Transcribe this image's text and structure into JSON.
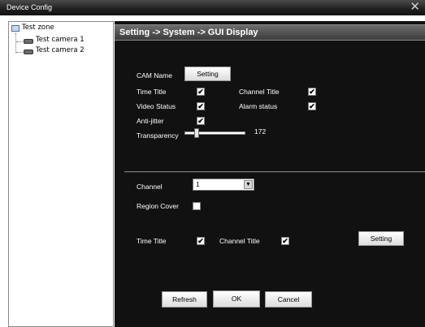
{
  "window": {
    "title": "Device Config",
    "close_glyph": "✕"
  },
  "tree": {
    "root": "Test zone",
    "cameras": [
      "Test camera 1",
      "Test camera 2"
    ]
  },
  "breadcrumb": "Setting -> System -> GUI Display",
  "cam_name": {
    "label": "CAM Name",
    "button": "Setting"
  },
  "options": {
    "time_title": {
      "label": "Time Title",
      "checked": true
    },
    "channel_title": {
      "label": "Channel Title",
      "checked": true
    },
    "video_status": {
      "label": "Video Status",
      "checked": true
    },
    "alarm_status": {
      "label": "Alarm status",
      "checked": true
    },
    "anti_jitter": {
      "label": "Anti-jitter",
      "checked": true
    }
  },
  "transparency": {
    "label": "Transparency",
    "value": "172",
    "fraction": 0.2
  },
  "channel": {
    "label": "Channel",
    "selected": "1"
  },
  "region_cover": {
    "label": "Region Cover",
    "checked": false
  },
  "overlay": {
    "time_title": {
      "label": "Time Title",
      "checked": true
    },
    "channel_title": {
      "label": "Channel Title",
      "checked": true
    },
    "button": "Setting"
  },
  "buttons": {
    "refresh": "Refresh",
    "ok": "OK",
    "cancel": "Cancel"
  },
  "check_glyph": "✔",
  "colors": {
    "panel_bg": "#111111",
    "header_bg": "#555555",
    "titlebar_bg": "#1f1f1f"
  }
}
